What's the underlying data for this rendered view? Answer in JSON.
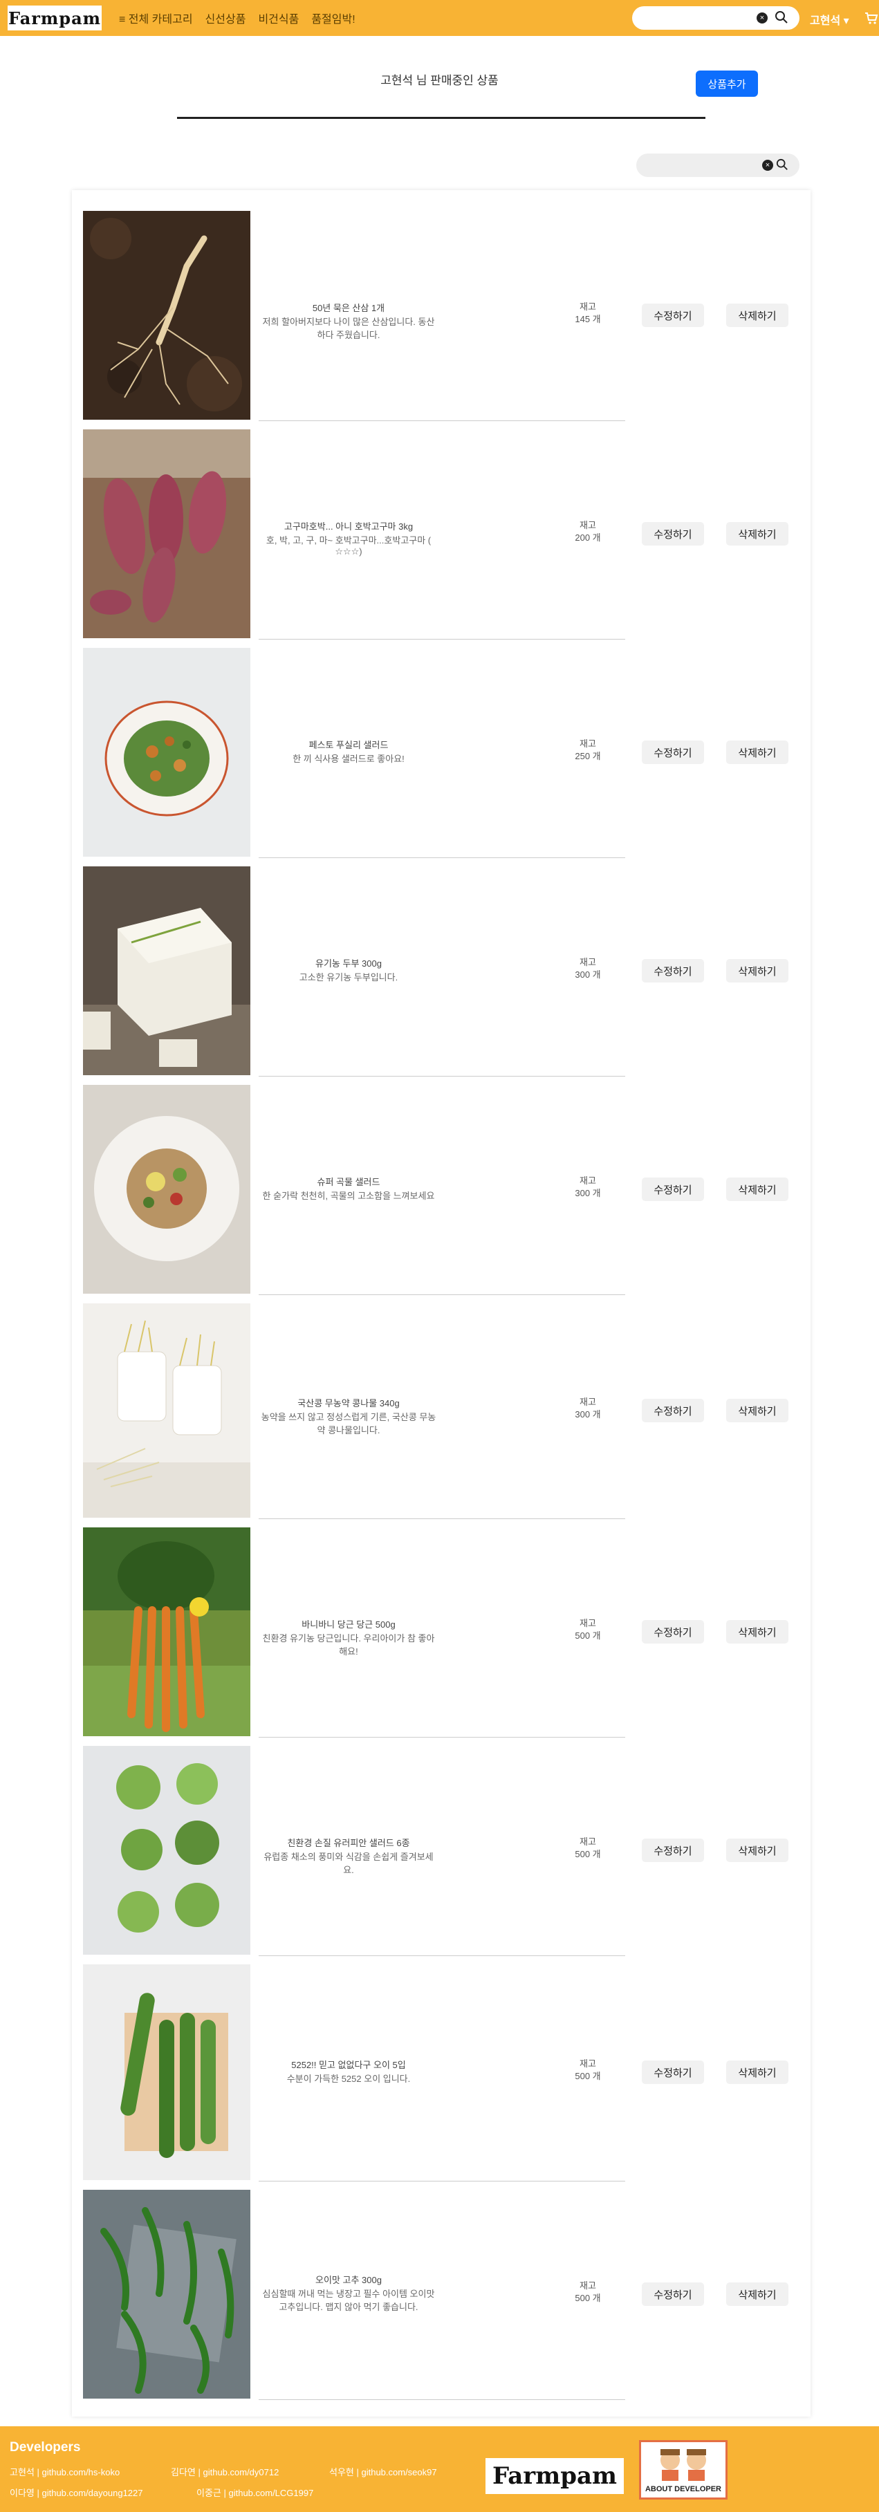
{
  "nav": {
    "logo": "Farmpam",
    "links": [
      "≡ 전체 카테고리",
      "신선상품",
      "비건식품",
      "품절임박!"
    ],
    "search_value": "",
    "user": "고현석 ▾"
  },
  "page": {
    "title": "고현석 님 판매중인 상품",
    "add_button": "상품추가",
    "list_search_value": ""
  },
  "products": [
    {
      "name": "50년 묵은 산삼 1개",
      "desc": "저희 할아버지보다 나이 많은 산삼입니다. 동산하다 주웠습니다.",
      "stock_label": "재고",
      "stock": "145 개",
      "edit": "수정하기",
      "delete": "삭제하기",
      "image": "ginseng-image"
    },
    {
      "name": "고구마호박... 아니 호박고구마 3kg",
      "desc": "호, 박, 고, 구, 마~ 호박고구마...호박고구마 ( ☆☆☆)",
      "stock_label": "재고",
      "stock": "200 개",
      "edit": "수정하기",
      "delete": "삭제하기",
      "image": "sweet-potato-image"
    },
    {
      "name": "페스토 푸실리 샐러드",
      "desc": "한 끼 식사용 샐러드로 좋아요!",
      "stock_label": "재고",
      "stock": "250 개",
      "edit": "수정하기",
      "delete": "삭제하기",
      "image": "pasta-salad-image"
    },
    {
      "name": "유기농 두부 300g",
      "desc": "고소한 유기농 두부입니다.",
      "stock_label": "재고",
      "stock": "300 개",
      "edit": "수정하기",
      "delete": "삭제하기",
      "image": "tofu-image"
    },
    {
      "name": "슈퍼 곡물 샐러드",
      "desc": "한 숟가락 천천히, 곡물의 고소함을 느껴보세요",
      "stock_label": "재고",
      "stock": "300 개",
      "edit": "수정하기",
      "delete": "삭제하기",
      "image": "grain-salad-image"
    },
    {
      "name": "국산콩 무농약 콩나물 340g",
      "desc": "농약을 쓰지 않고 정성스럽게 기른, 국산콩 무농약 콩나물입니다.",
      "stock_label": "재고",
      "stock": "300 개",
      "edit": "수정하기",
      "delete": "삭제하기",
      "image": "bean-sprouts-image"
    },
    {
      "name": "바니바니 당근 당근 500g",
      "desc": "친환경 유기농 당근입니다. 우리아이가 참 좋아해요!",
      "stock_label": "재고",
      "stock": "500 개",
      "edit": "수정하기",
      "delete": "삭제하기",
      "image": "carrot-image"
    },
    {
      "name": "친환경 손질 유러피안 샐러드 6종",
      "desc": "유럽종 채소의 풍미와 식감을 손쉽게 즐겨보세요.",
      "stock_label": "재고",
      "stock": "500 개",
      "edit": "수정하기",
      "delete": "삭제하기",
      "image": "lettuce-image"
    },
    {
      "name": "5252!! 믿고 없없다구 오이 5입",
      "desc": "수분이 가득한 5252 오이 입니다.",
      "stock_label": "재고",
      "stock": "500 개",
      "edit": "수정하기",
      "delete": "삭제하기",
      "image": "cucumber-image"
    },
    {
      "name": "오이맛 고추 300g",
      "desc": "심심할때 꺼내 먹는 냉장고 필수 아이템 오이맛 고추입니다. 맵지 않아 먹기 좋습니다.",
      "stock_label": "재고",
      "stock": "500 개",
      "edit": "수정하기",
      "delete": "삭제하기",
      "image": "pepper-image"
    }
  ],
  "footer": {
    "title": "Developers",
    "developers": [
      "고현석 | github.com/hs-koko",
      "김다연 | github.com/dy0712",
      "석우현 | github.com/seok97",
      "이다영 | github.com/dayoung1227",
      "이중근 | github.com/LCG1997"
    ],
    "logo": "Farmpam",
    "about": "ABOUT DEVELOPER"
  },
  "colors": {
    "brand": "#f8b334",
    "primary": "#0d6efd"
  }
}
